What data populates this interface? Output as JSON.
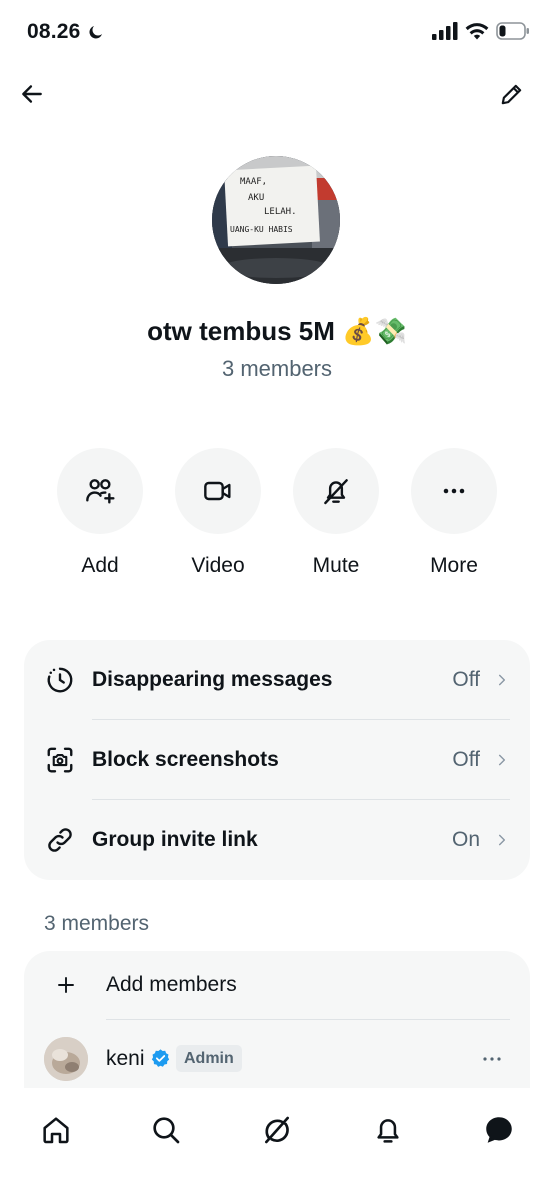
{
  "status_bar": {
    "time": "08.26",
    "icons": [
      "moon-icon",
      "signal-icon",
      "wifi-icon",
      "battery-icon"
    ]
  },
  "header": {
    "back_icon": "back-arrow-icon",
    "edit_icon": "pencil-icon"
  },
  "group": {
    "name": "otw tembus 5M 💰💸",
    "member_count": "3 members",
    "avatar_sign_lines": [
      "MAAF,",
      "AKU",
      "LELAH.",
      "UANG-KU HABIS"
    ]
  },
  "actions": [
    {
      "label": "Add",
      "icon": "add-people-icon"
    },
    {
      "label": "Video",
      "icon": "video-camera-icon"
    },
    {
      "label": "Mute",
      "icon": "bell-mute-icon"
    },
    {
      "label": "More",
      "icon": "more-dots-icon"
    }
  ],
  "settings": [
    {
      "label": "Disappearing messages",
      "value": "Off",
      "icon": "timer-icon"
    },
    {
      "label": "Block screenshots",
      "value": "Off",
      "icon": "screenshot-camera-icon"
    },
    {
      "label": "Group invite link",
      "value": "On",
      "icon": "link-icon"
    }
  ],
  "members_section": {
    "heading": "3 members",
    "add_label": "Add members",
    "members": [
      {
        "name": "keni",
        "badge": "Admin",
        "verified": true
      }
    ]
  },
  "bottom_nav": [
    {
      "name": "home",
      "icon": "home-icon"
    },
    {
      "name": "search",
      "icon": "search-icon"
    },
    {
      "name": "grok",
      "icon": "grok-icon"
    },
    {
      "name": "notifications",
      "icon": "bell-icon"
    },
    {
      "name": "messages",
      "icon": "message-bubble-icon"
    }
  ],
  "colors": {
    "text_primary": "#0f1419",
    "text_secondary": "#536471",
    "card_bg": "#f6f7f7",
    "action_bg": "#f4f5f5",
    "verified_blue": "#1d9bf0"
  }
}
